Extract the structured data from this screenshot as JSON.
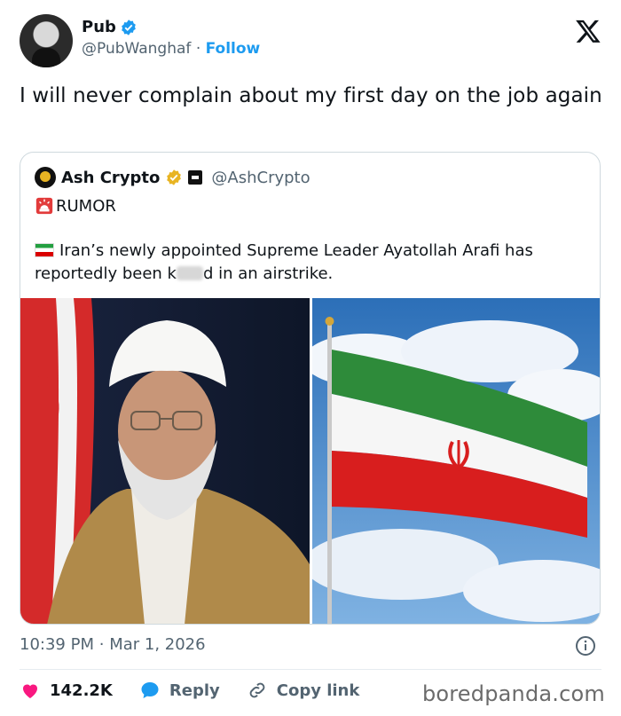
{
  "author": {
    "display_name": "Pub",
    "handle": "@PubWanghaf",
    "separator": "·",
    "follow_label": "Follow"
  },
  "tweet": {
    "text": "I will never complain about my first day on the job again"
  },
  "quoted": {
    "display_name": "Ash Crypto",
    "handle": "@AshCrypto",
    "line1": "RUMOR",
    "body_before": "Iran’s newly appointed Supreme Leader Ayatollah Arafi has reportedly been k",
    "body_after": "d in an airstrike."
  },
  "meta": {
    "time": "10:39 PM",
    "separator": "·",
    "date": "Mar 1, 2026"
  },
  "actions": {
    "likes": "142.2K",
    "reply_label": "Reply",
    "copy_label": "Copy link"
  },
  "watermark": "boredpanda.com",
  "colors": {
    "accent": "#1d9bf0",
    "like": "#f91880",
    "muted": "#536471",
    "verified_gold": "#e8b423"
  },
  "icons": [
    "verified-badge-icon",
    "x-logo-icon",
    "gold-verified-icon",
    "affiliate-badge-icon",
    "siren-icon",
    "iran-flag-icon",
    "info-icon",
    "heart-icon",
    "reply-icon",
    "link-icon"
  ]
}
